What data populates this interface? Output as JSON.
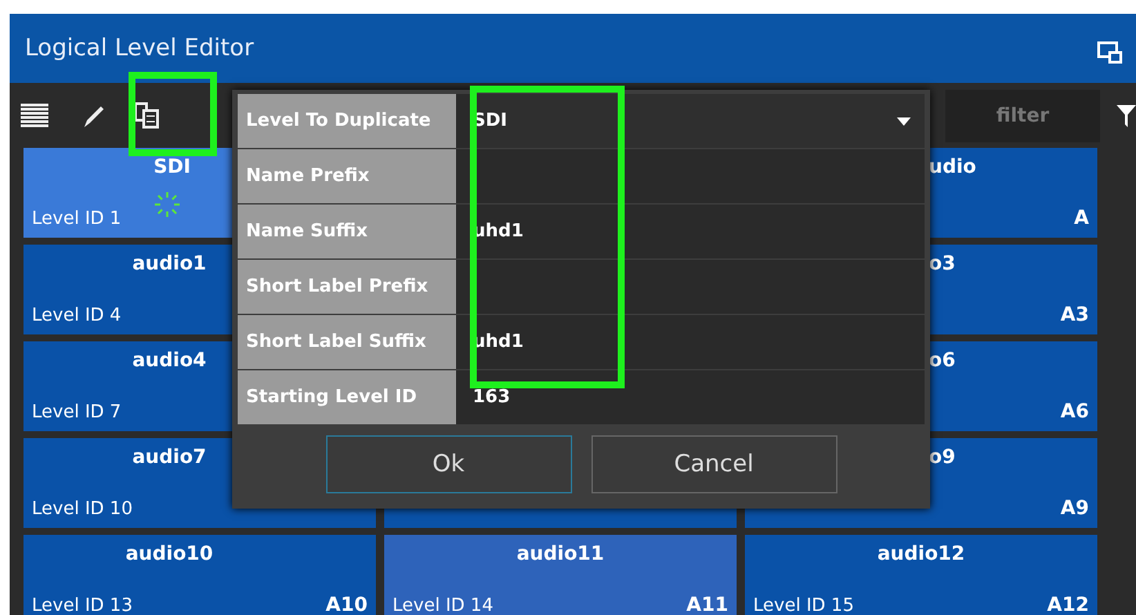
{
  "window": {
    "title": "Logical Level Editor"
  },
  "toolbar": {
    "filter": {
      "placeholder": "filter"
    }
  },
  "tiles": [
    {
      "name": "SDI",
      "level_id": "Level ID 1",
      "selected": true,
      "hovered": false
    },
    {
      "name": "udio",
      "short_label": "A",
      "selected": false,
      "hovered": false
    },
    {
      "name": "audio1",
      "level_id": "Level ID 4",
      "selected": false,
      "hovered": false
    },
    {
      "name": "o3",
      "short_label": "A3",
      "selected": false,
      "hovered": false
    },
    {
      "name": "audio4",
      "level_id": "Level ID 7",
      "selected": false,
      "hovered": false
    },
    {
      "name": "o6",
      "short_label": "A6",
      "selected": false,
      "hovered": false
    },
    {
      "name": "audio7",
      "level_id": "Level ID 10",
      "selected": false,
      "hovered": false
    },
    {
      "name": "o9",
      "short_label": "A9",
      "selected": false,
      "hovered": false
    },
    {
      "name": "audio10",
      "level_id": "Level ID 13",
      "short_label": "A10",
      "selected": false,
      "hovered": false
    },
    {
      "name": "audio11",
      "level_id": "Level ID 14",
      "short_label": "A11",
      "selected": false,
      "hovered": true
    },
    {
      "name": "audio12",
      "level_id": "Level ID 15",
      "short_label": "A12",
      "selected": false,
      "hovered": false
    }
  ],
  "dialog": {
    "fields": [
      {
        "label": "Level To Duplicate",
        "kind": "dropdown",
        "value": "SDI"
      },
      {
        "label": "Name Prefix",
        "kind": "text"
      },
      {
        "label": "Name Suffix",
        "kind": "text",
        "value": "uhd1"
      },
      {
        "label": "Short Label Prefix",
        "kind": "text"
      },
      {
        "label": "Short Label Suffix",
        "kind": "text",
        "value": "uhd1"
      },
      {
        "label": "Starting Level ID",
        "kind": "text",
        "value": "163"
      }
    ],
    "buttons": [
      {
        "label": "Ok",
        "kind": "primary"
      },
      {
        "label": "Cancel",
        "kind": "secondary"
      }
    ]
  }
}
